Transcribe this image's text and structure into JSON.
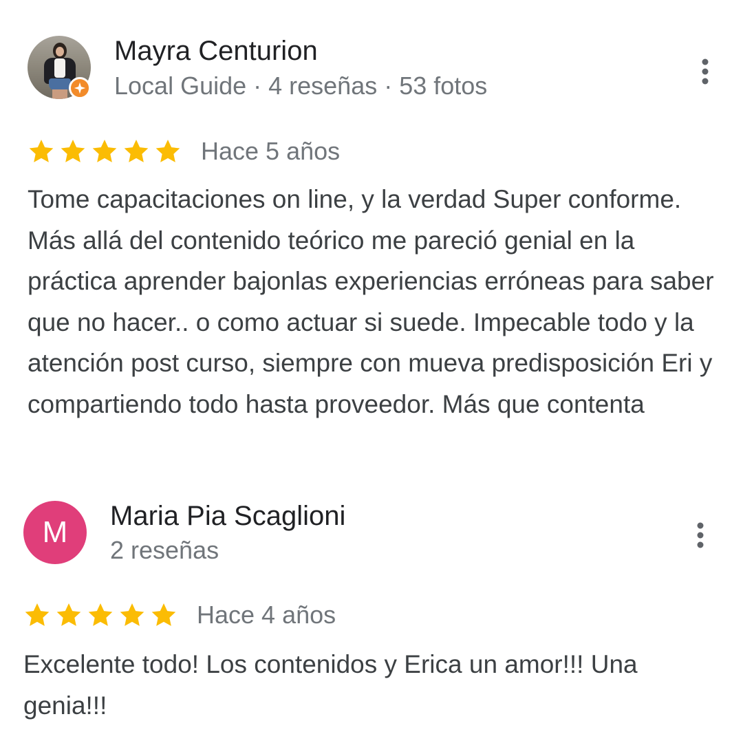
{
  "reviews": [
    {
      "author": "Mayra Centurion",
      "meta": "Local Guide · 4 reseñas · 53 fotos",
      "avatar_type": "photo",
      "badge_icon": "local-guide-star-icon",
      "rating": 5,
      "max_rating": 5,
      "date": "Hace 5 años",
      "text": "Tome capacitaciones on line, y la verdad Super conforme. Más allá del contenido teórico me pareció genial en la práctica aprender bajonlas experiencias erróneas para saber que no hacer.. o como actuar si suede. Impecable todo y la atención post curso, siempre con mueva predisposición Eri y compartiendo todo hasta proveedor. Más que contenta",
      "menu_icon": "more-vert-icon"
    },
    {
      "author": "Maria Pia Scaglioni",
      "meta": "2 reseñas",
      "avatar_type": "letter",
      "avatar_letter": "M",
      "rating": 5,
      "max_rating": 5,
      "date": "Hace 4 años",
      "text": "Excelente todo! Los contenidos y Erica un amor!!! Una genia!!!",
      "menu_icon": "more-vert-icon"
    }
  ],
  "colors": {
    "star": "#fbbc04",
    "badge": "#f28b2a",
    "letter_avatar": "#e03e7a",
    "secondary_text": "#70757a",
    "body_text": "#3c4043",
    "menu_icon": "#5f6368"
  }
}
